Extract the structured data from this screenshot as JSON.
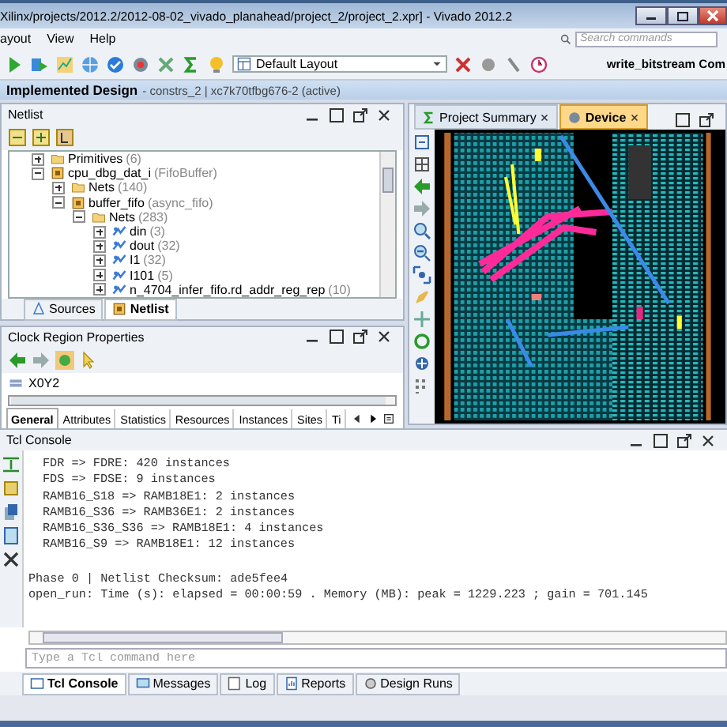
{
  "window": {
    "title": "Xilinx/projects/2012.2/2012-08-02_vivado_planahead/project_2/project_2.xpr] - Vivado 2012.2"
  },
  "menu": [
    "ayout",
    "View",
    "Help"
  ],
  "search": {
    "placeholder": "Search commands"
  },
  "toolbar": {
    "layout": "Default Layout",
    "status": "write_bitstream Com"
  },
  "design_header": {
    "title": "Implemented Design",
    "detail": "- constrs_2 | xc7k70tfbg676-2 (active)"
  },
  "netlist": {
    "title": "Netlist",
    "tree": [
      {
        "label": "Primitives",
        "detail": "(6)",
        "kind": "folder",
        "expanded": false
      },
      {
        "label": "cpu_dbg_dat_i",
        "detail": "(FifoBuffer)",
        "kind": "instance",
        "expanded": true,
        "children": [
          {
            "label": "Nets",
            "detail": "(140)",
            "kind": "folder",
            "expanded": false
          },
          {
            "label": "buffer_fifo",
            "detail": "(async_fifo)",
            "kind": "instance",
            "expanded": true,
            "children": [
              {
                "label": "Nets",
                "detail": "(283)",
                "kind": "folder",
                "expanded": true,
                "children": [
                  {
                    "label": "din",
                    "detail": "(3)",
                    "kind": "net",
                    "expanded": false
                  },
                  {
                    "label": "dout",
                    "detail": "(32)",
                    "kind": "net",
                    "expanded": false
                  },
                  {
                    "label": "I1",
                    "detail": "(32)",
                    "kind": "net",
                    "expanded": false
                  },
                  {
                    "label": "I101",
                    "detail": "(5)",
                    "kind": "net",
                    "expanded": false
                  },
                  {
                    "label": "n_4704_infer_fifo.rd_addr_reg_rep",
                    "detail": "(10)",
                    "kind": "net",
                    "expanded": false
                  }
                ]
              }
            ]
          }
        ]
      }
    ]
  },
  "left_tabs": [
    {
      "label": "Sources",
      "selected": false
    },
    {
      "label": "Netlist",
      "selected": true
    }
  ],
  "properties": {
    "title": "Clock Region Properties",
    "object": "X0Y2",
    "tabs": [
      {
        "label": "General",
        "selected": true
      },
      {
        "label": "Attributes",
        "selected": false
      },
      {
        "label": "Statistics",
        "selected": false
      },
      {
        "label": "Resources",
        "selected": false
      },
      {
        "label": "Instances",
        "selected": false
      },
      {
        "label": "Sites",
        "selected": false
      },
      {
        "label": "Ti",
        "selected": false
      }
    ]
  },
  "device_tabs": [
    {
      "label": "Project Summary",
      "selected": false
    },
    {
      "label": "Device",
      "selected": true
    }
  ],
  "console": {
    "title": "Tcl Console",
    "lines": [
      {
        "text": "FDR => FDRE: 420 instances",
        "indented": true
      },
      {
        "text": "FDS => FDSE: 9 instances",
        "indented": true
      },
      {
        "text": "RAMB16_S18 => RAMB18E1: 2 instances",
        "indented": true
      },
      {
        "text": "RAMB16_S36 => RAMB36E1: 2 instances",
        "indented": true
      },
      {
        "text": "RAMB16_S36_S36 => RAMB18E1: 4 instances",
        "indented": true
      },
      {
        "text": "RAMB16_S9 => RAMB18E1: 12 instances",
        "indented": true
      },
      {
        "text": "Phase 0 | Netlist Checksum: ade5fee4",
        "indented": false
      },
      {
        "text": "open_run: Time (s): elapsed = 00:00:59 . Memory (MB): peak = 1229.223 ; gain = 701.145",
        "indented": false
      }
    ],
    "placeholder": "Type a Tcl command here",
    "tabs": [
      {
        "label": "Tcl Console",
        "selected": true
      },
      {
        "label": "Messages",
        "selected": false
      },
      {
        "label": "Log",
        "selected": false
      },
      {
        "label": "Reports",
        "selected": false
      },
      {
        "label": "Design Runs",
        "selected": false
      }
    ]
  }
}
